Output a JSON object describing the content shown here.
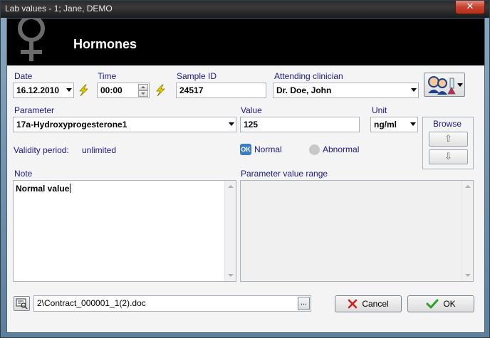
{
  "window": {
    "title": "Lab values - 1; Jane, DEMO",
    "close_glyph": "✕"
  },
  "header": {
    "title": "Hormones",
    "icon": "female-symbol-icon"
  },
  "date": {
    "label": "Date",
    "value": "16.12.2010"
  },
  "time": {
    "label": "Time",
    "value": "00:00"
  },
  "sample": {
    "label": "Sample ID",
    "value": "24517"
  },
  "clinician": {
    "label": "Attending clinician",
    "value": "Dr. Doe, John"
  },
  "parameter": {
    "label": "Parameter",
    "value": "17a-Hydroxyprogesterone1"
  },
  "value": {
    "label": "Value",
    "value": "125"
  },
  "unit": {
    "label": "Unit",
    "value": "ng/ml"
  },
  "browse": {
    "label": "Browse",
    "up_glyph": "⇧",
    "down_glyph": "⇩"
  },
  "validity": {
    "label": "Validity period:",
    "value": "unlimited"
  },
  "status": {
    "normal_badge": "OK",
    "normal_label": "Normal",
    "abnormal_label": "Abnormal",
    "selected": "Normal"
  },
  "note": {
    "label": "Note",
    "value": "Normal value"
  },
  "range": {
    "label": "Parameter value range",
    "value": ""
  },
  "attachment": {
    "path": "2\\Contract_000001_1(2).doc",
    "browse_label": "..."
  },
  "buttons": {
    "cancel_label": "Cancel",
    "ok_label": "OK"
  },
  "colors": {
    "label_text": "#1a1a8a",
    "ok_check": "#2aa12a",
    "cancel_x": "#d02020",
    "accent": "#3a7fc4"
  }
}
